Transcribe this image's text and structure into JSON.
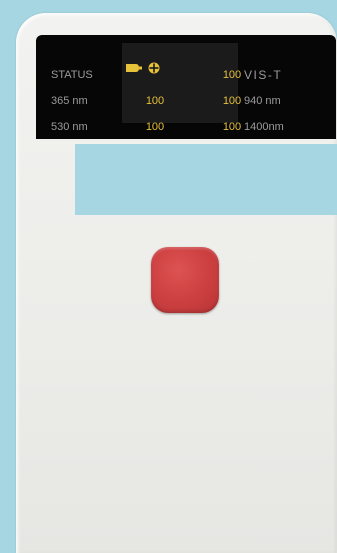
{
  "display": {
    "left_labels": [
      "STATUS",
      "365 nm",
      "530 nm"
    ],
    "right_labels": [
      "VIS-T",
      "940 nm",
      "1400nm"
    ],
    "values": {
      "status_right": "100",
      "row2_left": "100",
      "row2_right": "100",
      "row3_left": "100",
      "row3_right": "100"
    },
    "status_icons": [
      "battery-icon",
      "plus-circle-icon"
    ]
  },
  "colors": {
    "background": "#a5d6e2",
    "device_body": "#eeeeeb",
    "screen": "#060606",
    "value_text": "#e6c13a",
    "label_text": "#9b9b9b",
    "button": "#cc3f40"
  },
  "controls": {
    "main_button": "red-square-button"
  }
}
